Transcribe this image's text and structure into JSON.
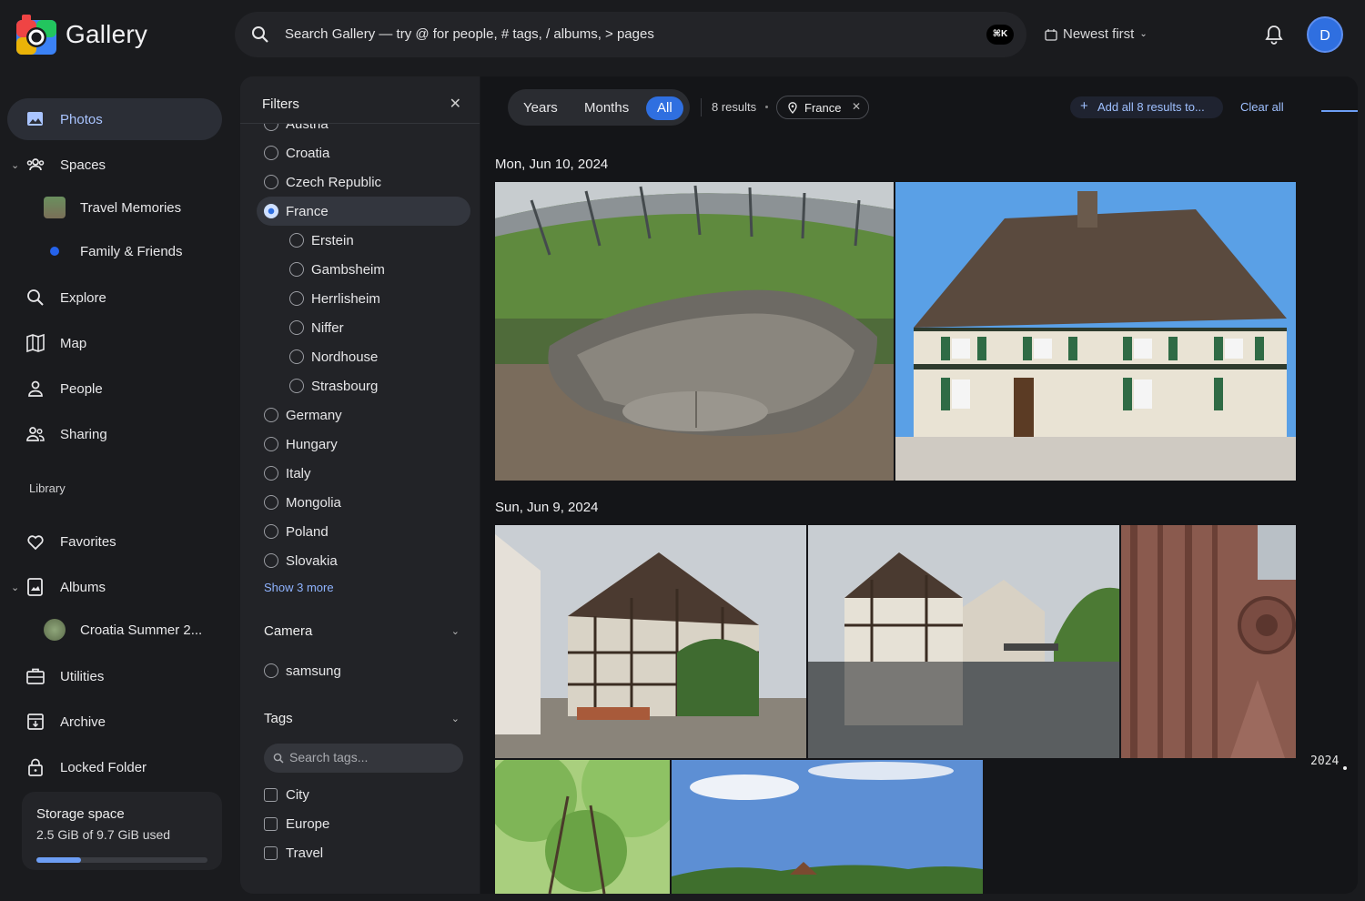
{
  "header": {
    "logo_text": "Gallery",
    "search_placeholder": "Search Gallery — try @ for people, # tags, / albums, > pages",
    "shortcut": "⌘K",
    "sort_label": "Newest first",
    "avatar_initial": "D"
  },
  "sidebar": {
    "photos": "Photos",
    "spaces": "Spaces",
    "space_items": [
      "Travel Memories",
      "Family & Friends"
    ],
    "explore": "Explore",
    "map": "Map",
    "people": "People",
    "sharing": "Sharing",
    "library_label": "Library",
    "favorites": "Favorites",
    "albums": "Albums",
    "album_items": [
      "Croatia Summer 2..."
    ],
    "utilities": "Utilities",
    "archive": "Archive",
    "locked_folder": "Locked Folder",
    "storage": {
      "title": "Storage space",
      "used": "2.5 GiB of 9.7 GiB used",
      "fraction": 0.26
    }
  },
  "filters": {
    "title": "Filters",
    "countries_partial": "Austria",
    "countries": [
      "Croatia",
      "Czech Republic",
      "France",
      "Germany",
      "Hungary",
      "Italy",
      "Mongolia",
      "Poland",
      "Slovakia"
    ],
    "selected_country": "France",
    "cities": [
      "Erstein",
      "Gambsheim",
      "Herrlisheim",
      "Niffer",
      "Nordhouse",
      "Strasbourg"
    ],
    "show_more": "Show 3 more",
    "camera_title": "Camera",
    "cameras": [
      "samsung"
    ],
    "tags_title": "Tags",
    "tags_search_placeholder": "Search tags...",
    "tags": [
      "City",
      "Europe",
      "Travel"
    ]
  },
  "main": {
    "segments": [
      "Years",
      "Months",
      "All"
    ],
    "active_segment": "All",
    "results": "8 results",
    "active_chip": "France",
    "add_all": "Add all 8 results to...",
    "clear_all": "Clear all",
    "groups": [
      {
        "date": "Mon, Jun 10, 2024"
      },
      {
        "date": "Sun, Jun 9, 2024"
      }
    ],
    "year_marker": "2024"
  }
}
